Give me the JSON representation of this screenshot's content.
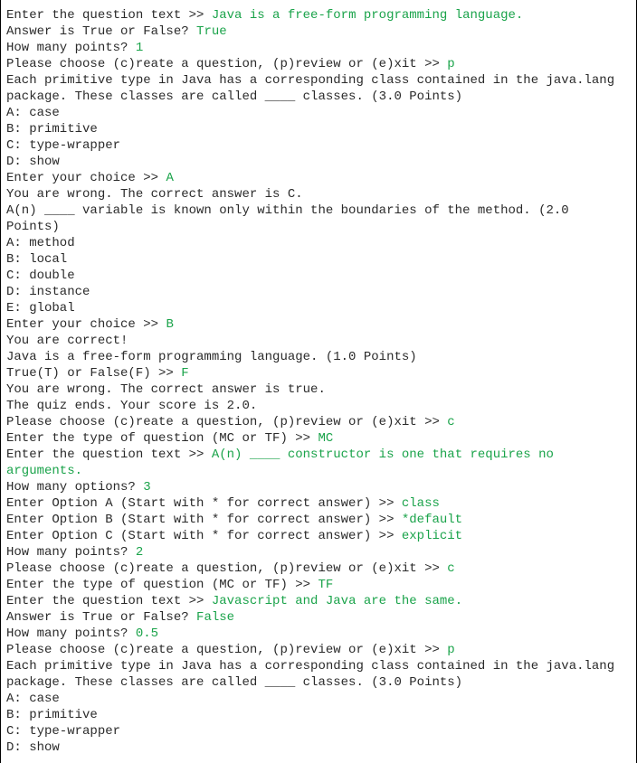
{
  "lines": [
    {
      "prompt": "Enter the question text >> ",
      "input": "Java is a free-form programming language."
    },
    {
      "prompt": "Answer is True or False? ",
      "input": "True"
    },
    {
      "prompt": "How many points? ",
      "input": "1"
    },
    {
      "prompt": "Please choose (c)reate a question, (p)review or (e)xit >> ",
      "input": "p"
    },
    {
      "prompt": "Each primitive type in Java has a corresponding class contained in the java.lang package. These classes are called ____ classes. (3.0 Points)"
    },
    {
      "prompt": "A: case"
    },
    {
      "prompt": "B: primitive"
    },
    {
      "prompt": "C: type-wrapper"
    },
    {
      "prompt": "D: show"
    },
    {
      "prompt": "Enter your choice >> ",
      "input": "A"
    },
    {
      "prompt": "You are wrong. The correct answer is C."
    },
    {
      "prompt": "A(n) ____ variable is known only within the boundaries of the method. (2.0 Points)"
    },
    {
      "prompt": "A: method"
    },
    {
      "prompt": "B: local"
    },
    {
      "prompt": "C: double"
    },
    {
      "prompt": "D: instance"
    },
    {
      "prompt": "E: global"
    },
    {
      "prompt": "Enter your choice >> ",
      "input": "B"
    },
    {
      "prompt": "You are correct!"
    },
    {
      "prompt": "Java is a free-form programming language. (1.0 Points)"
    },
    {
      "prompt": "True(T) or False(F) >> ",
      "input": "F"
    },
    {
      "prompt": "You are wrong. The correct answer is true."
    },
    {
      "prompt": "The quiz ends. Your score is 2.0."
    },
    {
      "prompt": "Please choose (c)reate a question, (p)review or (e)xit >> ",
      "input": "c"
    },
    {
      "prompt": "Enter the type of question (MC or TF) >> ",
      "input": "MC"
    },
    {
      "prompt": "Enter the question text >> ",
      "input": "A(n) ____ constructor is one that requires no arguments."
    },
    {
      "prompt": "How many options? ",
      "input": "3"
    },
    {
      "prompt": "Enter Option A (Start with * for correct answer) >> ",
      "input": "class"
    },
    {
      "prompt": "Enter Option B (Start with * for correct answer) >> ",
      "input": "*default"
    },
    {
      "prompt": "Enter Option C (Start with * for correct answer) >> ",
      "input": "explicit"
    },
    {
      "prompt": "How many points? ",
      "input": "2"
    },
    {
      "prompt": "Please choose (c)reate a question, (p)review or (e)xit >> ",
      "input": "c"
    },
    {
      "prompt": "Enter the type of question (MC or TF) >> ",
      "input": "TF"
    },
    {
      "prompt": "Enter the question text >> ",
      "input": "Javascript and Java are the same."
    },
    {
      "prompt": "Answer is True or False? ",
      "input": "False"
    },
    {
      "prompt": "How many points? ",
      "input": "0.5"
    },
    {
      "prompt": "Please choose (c)reate a question, (p)review or (e)xit >> ",
      "input": "p"
    },
    {
      "prompt": "Each primitive type in Java has a corresponding class contained in the java.lang package. These classes are called ____ classes. (3.0 Points)"
    },
    {
      "prompt": "A: case"
    },
    {
      "prompt": "B: primitive"
    },
    {
      "prompt": "C: type-wrapper"
    },
    {
      "prompt": "D: show"
    }
  ]
}
